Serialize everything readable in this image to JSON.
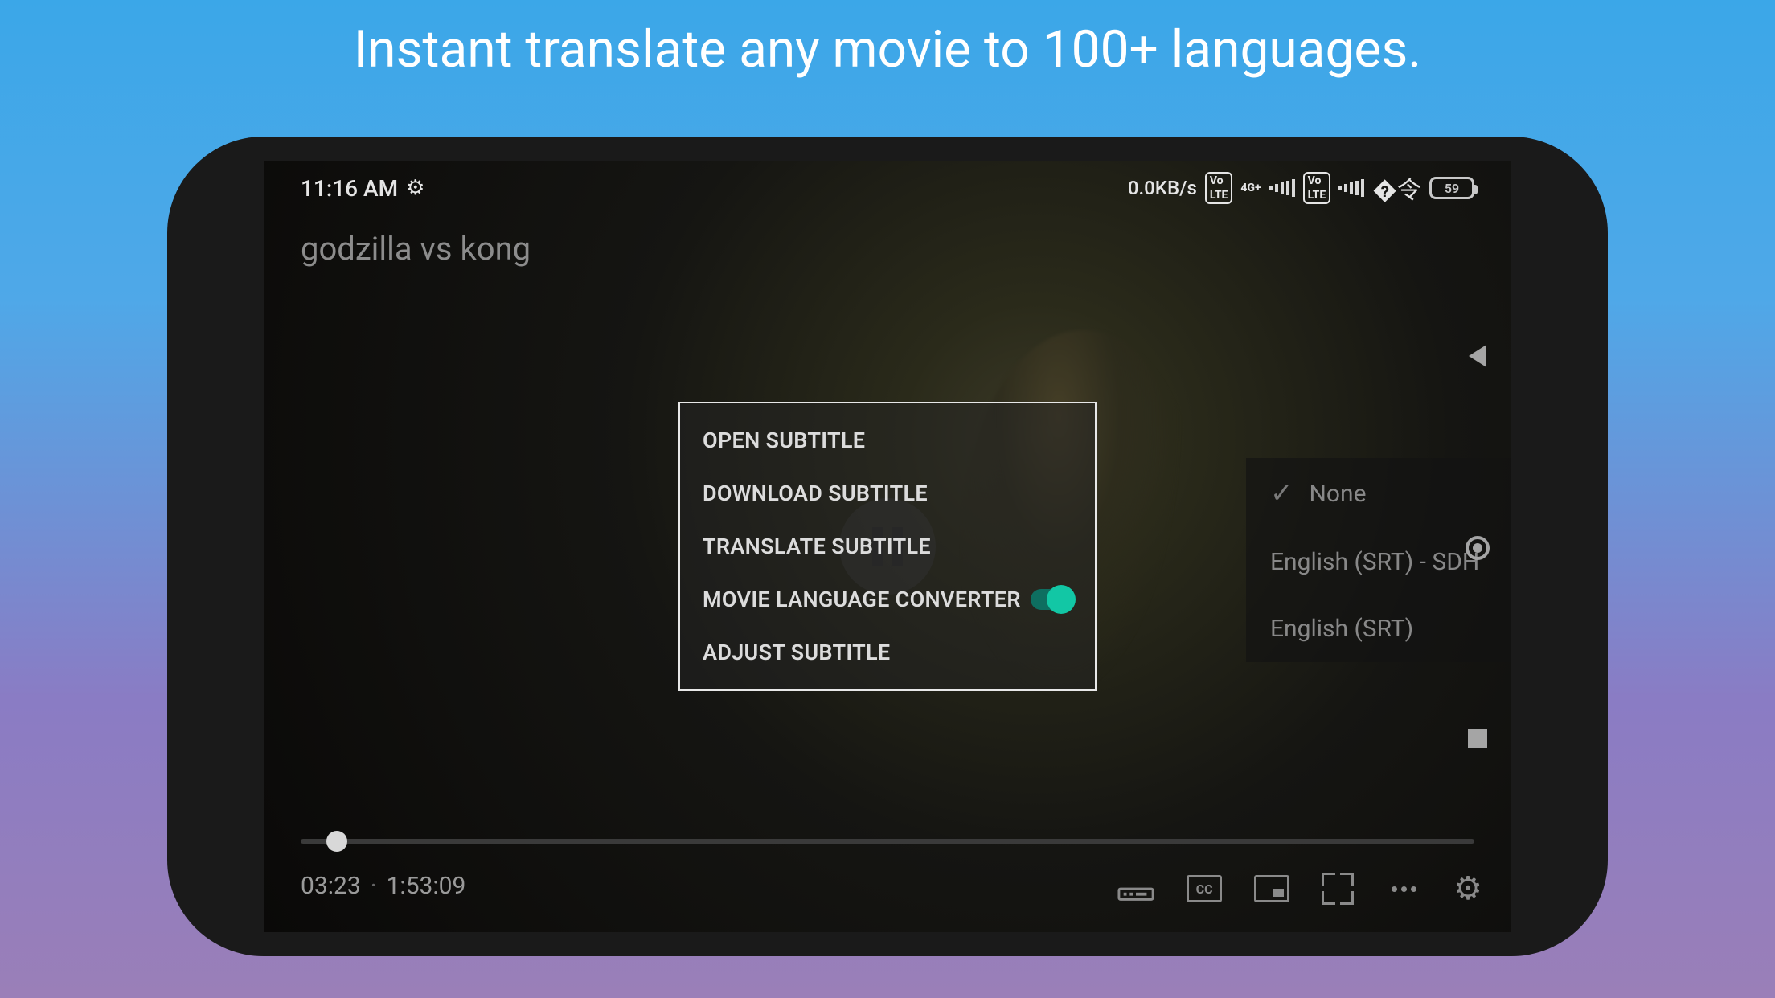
{
  "headline": "Instant translate any movie to 100+ languages.",
  "status": {
    "time": "11:16 AM",
    "speed": "0.0KB/s",
    "net1": "4G+",
    "net2": "Vo LTE",
    "battery": "59"
  },
  "movie_title": "godzilla vs kong",
  "menu": {
    "open": "OPEN SUBTITLE",
    "download": "DOWNLOAD SUBTITLE",
    "translate": "TRANSLATE SUBTITLE",
    "converter": "MOVIE LANGUAGE CONVERTER",
    "adjust": "ADJUST SUBTITLE"
  },
  "playback": {
    "current": "03:23",
    "duration": "1:53:09"
  },
  "subtitle_panel": {
    "none": "None",
    "eng_sdh": "English (SRT) - SDH",
    "eng": "English (SRT)"
  }
}
